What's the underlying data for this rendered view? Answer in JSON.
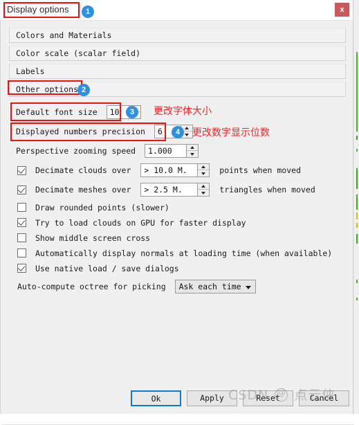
{
  "window": {
    "title": "Display options",
    "close_label": "x"
  },
  "sections": [
    {
      "label": "Colors and Materials"
    },
    {
      "label": "Color scale (scalar field)"
    },
    {
      "label": "Labels"
    },
    {
      "label": "Other options"
    }
  ],
  "options": {
    "default_font_size": {
      "label": "Default font size",
      "value": "10"
    },
    "displayed_numbers_precision": {
      "label": "Displayed numbers precision",
      "value": "6"
    },
    "perspective_zooming_speed": {
      "label": "Perspective zooming speed",
      "value": "1.000"
    },
    "decimate_clouds": {
      "label": "Decimate clouds over",
      "value": "> 10.0 M.",
      "suffix": "points when moved",
      "checked": true
    },
    "decimate_meshes": {
      "label": "Decimate meshes over",
      "value": "> 2.5 M.",
      "suffix": "triangles when moved",
      "checked": true
    },
    "draw_rounded_points": {
      "label": "Draw rounded points (slower)",
      "checked": false
    },
    "load_clouds_gpu": {
      "label": "Try to load clouds on GPU for faster display",
      "checked": true
    },
    "show_middle_cross": {
      "label": "Show middle screen cross",
      "checked": false
    },
    "auto_display_normals": {
      "label": "Automatically display normals at loading time (when available)",
      "checked": false
    },
    "native_dialogs": {
      "label": "Use native load / save dialogs",
      "checked": true
    },
    "auto_octree": {
      "label": "Auto-compute octree for picking",
      "value": "Ask each time"
    }
  },
  "buttons": {
    "ok": "Ok",
    "apply": "Apply",
    "reset": "Reset",
    "cancel": "Cancel"
  },
  "annotations": {
    "badges": [
      "1",
      "2",
      "3",
      "4"
    ],
    "notes": [
      "更改字体大小",
      "更改数字显示位数"
    ]
  },
  "watermark": {
    "prefix": "CSDN",
    "handle": "点云侠"
  },
  "colors": {
    "accent_badge": "#2f8fe0",
    "annotation_red": "#f40f0f",
    "close_red": "#c75b5b",
    "default_button_border": "#0a7cd4"
  }
}
